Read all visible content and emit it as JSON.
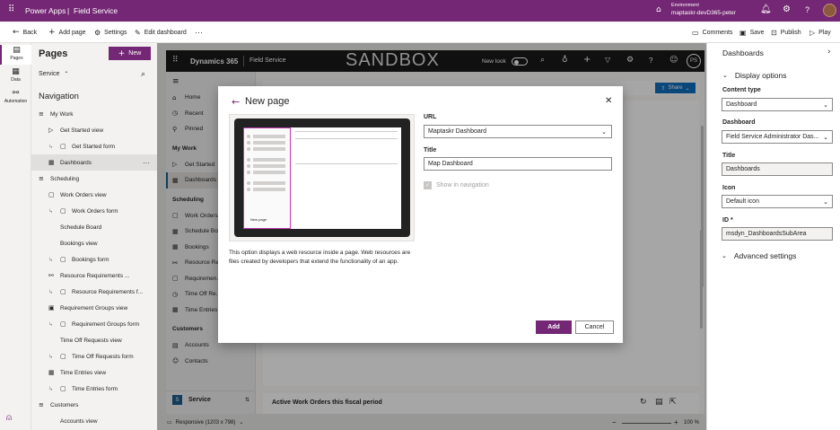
{
  "topbar": {
    "app_name": "Power Apps",
    "separator": "|",
    "solution_name": "Field Service",
    "env_label": "Environment",
    "env_name": "maptaskr-devD365-peter"
  },
  "rail": {
    "items": [
      {
        "label": "Pages",
        "icon": "pages-icon"
      },
      {
        "label": "Data",
        "icon": "data-icon"
      },
      {
        "label": "Automation",
        "icon": "automation-icon"
      }
    ]
  },
  "commandbar": {
    "back": "Back",
    "add_page": "Add page",
    "settings": "Settings",
    "edit_dashboard": "Edit dashboard",
    "more": "···",
    "comments": "Comments",
    "save": "Save",
    "publish": "Publish",
    "play": "Play"
  },
  "pages_panel": {
    "title": "Pages",
    "new_button": "New",
    "area_select": "Service",
    "navigation_heading": "Navigation",
    "items": [
      {
        "label": "My Work",
        "indent": 0,
        "icon": "list-icon"
      },
      {
        "label": "Get Started view",
        "indent": 1,
        "icon": "view-icon"
      },
      {
        "label": "Get Started form",
        "indent": 2,
        "icon": "form-icon"
      },
      {
        "label": "Dashboards",
        "indent": 1,
        "icon": "dashboard-icon",
        "selected": true
      },
      {
        "label": "Scheduling",
        "indent": 0,
        "icon": "list-icon"
      },
      {
        "label": "Work Orders view",
        "indent": 1,
        "icon": "form-icon"
      },
      {
        "label": "Work Orders form",
        "indent": 2,
        "icon": "form-icon"
      },
      {
        "label": "Schedule Board",
        "indent": 1,
        "icon": "blank"
      },
      {
        "label": "Bookings view",
        "indent": 1,
        "icon": "blank"
      },
      {
        "label": "Bookings form",
        "indent": 2,
        "icon": "form-icon"
      },
      {
        "label": "Resource Requirements ...",
        "indent": 1,
        "icon": "resource-icon"
      },
      {
        "label": "Resource Requirements f...",
        "indent": 2,
        "icon": "form-icon"
      },
      {
        "label": "Requirement Groups view",
        "indent": 1,
        "icon": "group-icon"
      },
      {
        "label": "Requirement Groups form",
        "indent": 2,
        "icon": "form-icon"
      },
      {
        "label": "Time Off Requests view",
        "indent": 1,
        "icon": "blank"
      },
      {
        "label": "Time Off Requests form",
        "indent": 2,
        "icon": "form-icon"
      },
      {
        "label": "Time Entries view",
        "indent": 1,
        "icon": "calendar-icon"
      },
      {
        "label": "Time Entries form",
        "indent": 2,
        "icon": "form-icon"
      },
      {
        "label": "Customers",
        "indent": 0,
        "icon": "list-icon"
      },
      {
        "label": "Accounts view",
        "indent": 1,
        "icon": "blank"
      }
    ]
  },
  "preview": {
    "app_title": "Dynamics 365",
    "area_title": "Field Service",
    "watermark": "SANDBOX",
    "new_look": "New look",
    "initials": "PS",
    "share": "Share",
    "sitemap": [
      {
        "label": "Home",
        "type": "item",
        "icon": "home-icon"
      },
      {
        "label": "Recent",
        "type": "item",
        "icon": "clock-icon"
      },
      {
        "label": "Pinned",
        "type": "item",
        "icon": "pin-icon"
      },
      {
        "label": "My Work",
        "type": "group"
      },
      {
        "label": "Get Started",
        "type": "item",
        "icon": "play-icon"
      },
      {
        "label": "Dashboards",
        "type": "item",
        "icon": "dashboard-icon",
        "selected": true
      },
      {
        "label": "Scheduling",
        "type": "group"
      },
      {
        "label": "Work Orders",
        "type": "item",
        "icon": "form-icon"
      },
      {
        "label": "Schedule Bo...",
        "type": "item",
        "icon": "calendar-icon"
      },
      {
        "label": "Bookings",
        "type": "item",
        "icon": "calendar-icon"
      },
      {
        "label": "Resource Re...",
        "type": "item",
        "icon": "resource-icon"
      },
      {
        "label": "Requiremen...",
        "type": "item",
        "icon": "form-icon"
      },
      {
        "label": "Time Off Re...",
        "type": "item",
        "icon": "clock-icon"
      },
      {
        "label": "Time Entries",
        "type": "item",
        "icon": "calendar-icon"
      },
      {
        "label": "Customers",
        "type": "group"
      },
      {
        "label": "Accounts",
        "type": "item",
        "icon": "account-icon"
      },
      {
        "label": "Contacts",
        "type": "item",
        "icon": "contact-icon"
      }
    ],
    "area_switch_badge": "S",
    "area_switch_label": "Service",
    "bottom_dashboard": "Active Work Orders this fiscal period"
  },
  "statusbar": {
    "responsive": "Responsive (1203 x 798)",
    "zoom": "100 %",
    "zoom_fraction": 0.3
  },
  "dialog": {
    "title": "New page",
    "url_label": "URL",
    "url_value": "Maptaskr Dashboard",
    "title_label": "Title",
    "title_value": "Map Dashboard",
    "show_in_nav": "Show in navigation",
    "thumbnail_caption": "New page",
    "description": "This option displays a web resource inside a page. Web resources are files created by developers that extend the functionality of an app.",
    "add": "Add",
    "cancel": "Cancel"
  },
  "right_panel": {
    "title": "Dashboards",
    "display_options": "Display options",
    "content_type_label": "Content type",
    "content_type_value": "Dashboard",
    "dashboard_label": "Dashboard",
    "dashboard_value": "Field Service Administrator Das...",
    "title_label": "Title",
    "title_value": "Dashboards",
    "icon_label": "Icon",
    "icon_value": "Default icon",
    "id_label": "ID *",
    "id_value": "msdyn_DashboardsSubArea",
    "advanced": "Advanced settings"
  },
  "colors": {
    "brand": "#742774",
    "preview_header": "#1a1a1a",
    "share_blue": "#106ebe"
  }
}
